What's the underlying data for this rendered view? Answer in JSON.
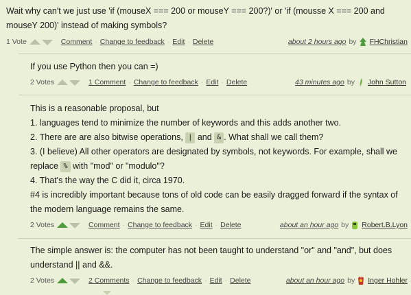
{
  "comments": [
    {
      "text_lines": [
        "Wait why can't we just use 'if (mouseX === 200 or mouseY === 200?)' or 'if (mousse X === 200 and",
        "mouseY 200)' instead of making symbols?"
      ],
      "votes": "1 Vote",
      "actions": [
        "Comment",
        "Change to feedback",
        "Edit",
        "Delete"
      ],
      "time": "about 2 hours ago",
      "by": "by",
      "author": "FHChristian"
    },
    {
      "text_lines": [
        "If you use Python then you can =)"
      ],
      "votes": "2 Votes",
      "actions": [
        "1 Comment",
        "Change to feedback",
        "Edit",
        "Delete"
      ],
      "time": "43 minutes ago",
      "by": "by",
      "author": "John Sutton"
    },
    {
      "text_parts": {
        "l1": "This is a reasonable proposal, but",
        "l2": "1. languages tend to minimize the number of keywords and this adds another two.",
        "l3a": "2. There are are also bitwise operations,",
        "l3code1": "|",
        "l3b": "and",
        "l3code2": "&",
        "l3c": ". What shall we call them?",
        "l4": "3. (I believe) All other operators are designated by symbols, not keywords. For example, shall we",
        "l5a": "replace",
        "l5code": "%",
        "l5b": "with \"mod\" or \"modulo\"?",
        "l6": "4. That's the way the C did it, circa 1970.",
        "l7": "#4 is incredibly important because tons of old code can be easily dragged forward if the syntax of",
        "l8": "the modern language remains the same."
      },
      "votes": "2 Votes",
      "actions": [
        "Comment",
        "Change to feedback",
        "Edit",
        "Delete"
      ],
      "time": "about an hour ago",
      "by": "by",
      "author": "Robert.B.Lyon"
    },
    {
      "text_lines": [
        "The simple answer is: the computer has not been taught to understand \"or\" and \"and\", but does",
        "understand || and &&."
      ],
      "votes": "2 Votes",
      "actions": [
        "2 Comments",
        "Change to feedback",
        "Edit",
        "Delete"
      ],
      "time": "about an hour ago",
      "by": "by",
      "author": "Inger Hohler"
    }
  ],
  "colors": {
    "background": "#ebf0d8",
    "vote_active": "#4e9a3c",
    "vote_inactive": "#b9c2a8",
    "divider": "#c9d1b3"
  }
}
